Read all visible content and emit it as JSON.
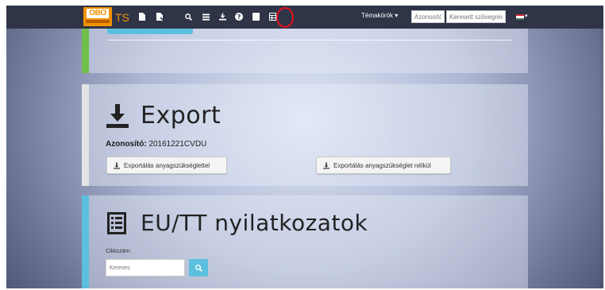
{
  "navbar": {
    "logo_text": "OBO",
    "app_name": "TS",
    "icons": [
      "file-icon",
      "file-flag-icon",
      "search-icon",
      "list-icon",
      "download-icon",
      "help-icon",
      "book-icon",
      "table-icon"
    ],
    "topics_label": "Témakörök ▾",
    "id_placeholder": "Azonosító",
    "search_placeholder": "Keresett szövegrész",
    "language_flag": "hu-flag-icon"
  },
  "colors": {
    "accent_orange": "#f39200",
    "green_bar": "#6fbf4a",
    "gray_bar": "#e4e4e4",
    "blue_bar": "#5bc0de",
    "highlight_red": "#e8101c"
  },
  "export_section": {
    "title": "Export",
    "id_label": "Azonosító:",
    "id_value": "20161221CVDU",
    "btn_with_materials": "Exportálás anyagszükséglettel",
    "btn_without_materials": "Exportálás anyagszükséglet nélkül"
  },
  "declarations_section": {
    "title": "EU/TT nyilatkozatok",
    "field_label": "Cikkszám:",
    "search_placeholder": "Keresés"
  }
}
